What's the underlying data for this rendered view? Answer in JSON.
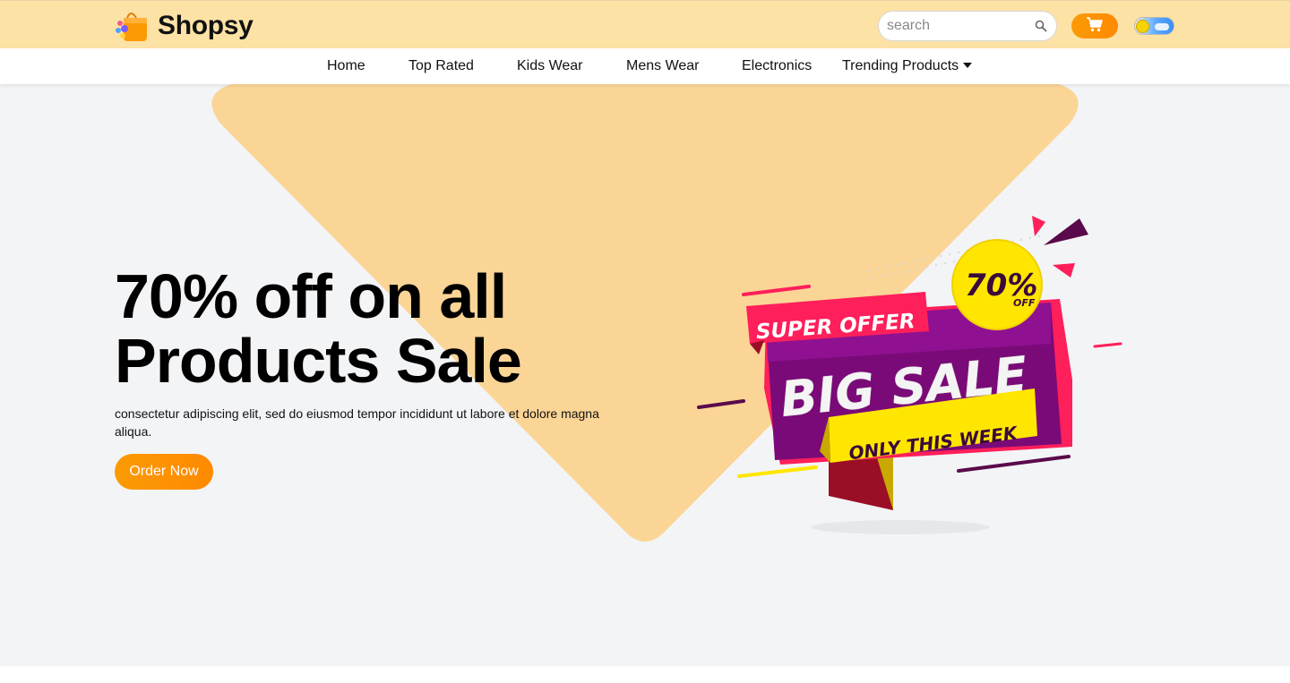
{
  "brand": {
    "name": "Shopsy"
  },
  "search": {
    "placeholder": "search"
  },
  "nav": {
    "items": [
      {
        "label": "Home"
      },
      {
        "label": "Top Rated"
      },
      {
        "label": "Kids Wear"
      },
      {
        "label": "Mens Wear"
      },
      {
        "label": "Electronics"
      },
      {
        "label": "Trending Products"
      }
    ]
  },
  "hero": {
    "headline_line1": "70% off on all",
    "headline_line2": "Products Sale",
    "description": "consectetur adipiscing elit, sed do eiusmod tempor incididunt ut labore et dolore magna aliqua.",
    "cta_label": "Order Now"
  },
  "sale_banner": {
    "super_offer": "SUPER OFFER",
    "big_sale": "BIG SALE",
    "only_this_week": "ONLY THIS WEEK",
    "discount": "70%",
    "discount_suffix": "OFF"
  },
  "colors": {
    "topbar": "#fde2a6",
    "accent": "#fb9a05",
    "hero_bg": "#f3f4f6",
    "triangle": "#fbd596",
    "banner_purple": "#7a0a78",
    "banner_pink": "#ff1f5a",
    "banner_yellow": "#ffe600"
  },
  "icons": {
    "logo": "shopping-bag-icon",
    "search": "search-icon",
    "cart": "cart-icon",
    "theme": "theme-toggle-icon",
    "caret": "caret-down-icon"
  }
}
